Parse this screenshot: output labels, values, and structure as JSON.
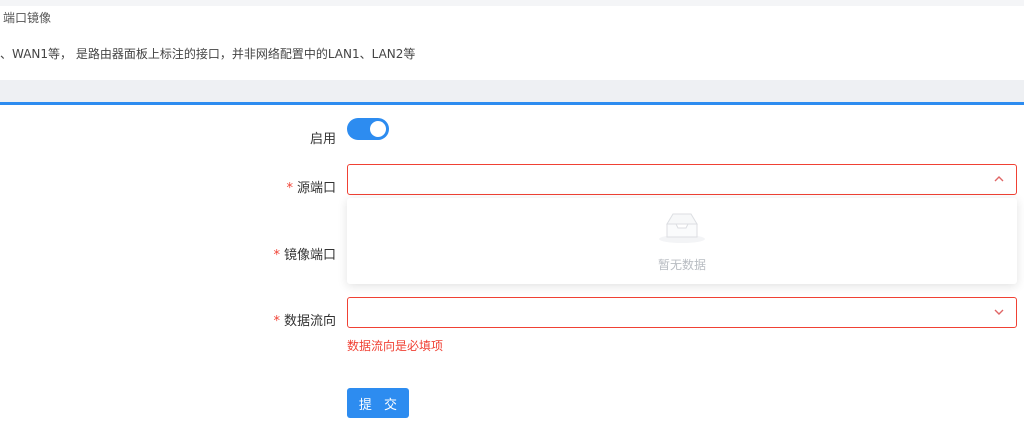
{
  "page": {
    "title": "端口镜像",
    "note": "、WAN1等， 是路由器面板上标注的接口，并非网络配置中的LAN1、LAN2等"
  },
  "form": {
    "enable": {
      "label": "启用",
      "on": true
    },
    "source_port": {
      "label": "源端口",
      "required_mark": "*",
      "value": ""
    },
    "mirror_port": {
      "label": "镜像端口",
      "required_mark": "*"
    },
    "direction": {
      "label": "数据流向",
      "required_mark": "*",
      "value": "",
      "error": "数据流向是必填项"
    },
    "dropdown": {
      "empty_text": "暂无数据"
    },
    "submit_label": "提 交"
  },
  "colors": {
    "accent": "#2d8cf0",
    "error": "#f04134"
  }
}
